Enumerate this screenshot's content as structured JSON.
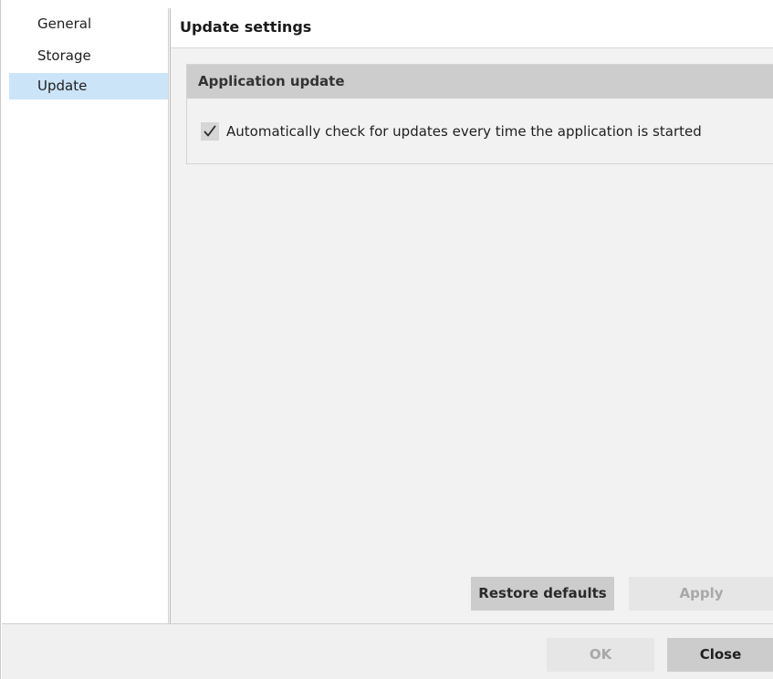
{
  "nav": {
    "items": [
      {
        "label": "General",
        "selected": false
      },
      {
        "label": "Storage",
        "selected": false
      },
      {
        "label": "Update",
        "selected": true
      }
    ],
    "selected_color": "#cce4f7"
  },
  "content": {
    "title": "Update settings",
    "group": {
      "title": "Application update",
      "checkbox": {
        "label": "Automatically check for updates every time the application is started",
        "checked": true,
        "icon": "checkmark-icon"
      }
    },
    "buttons": {
      "restore_defaults": "Restore defaults",
      "apply": "Apply",
      "apply_enabled": false
    }
  },
  "footer": {
    "ok": "OK",
    "ok_enabled": false,
    "close": "Close"
  }
}
